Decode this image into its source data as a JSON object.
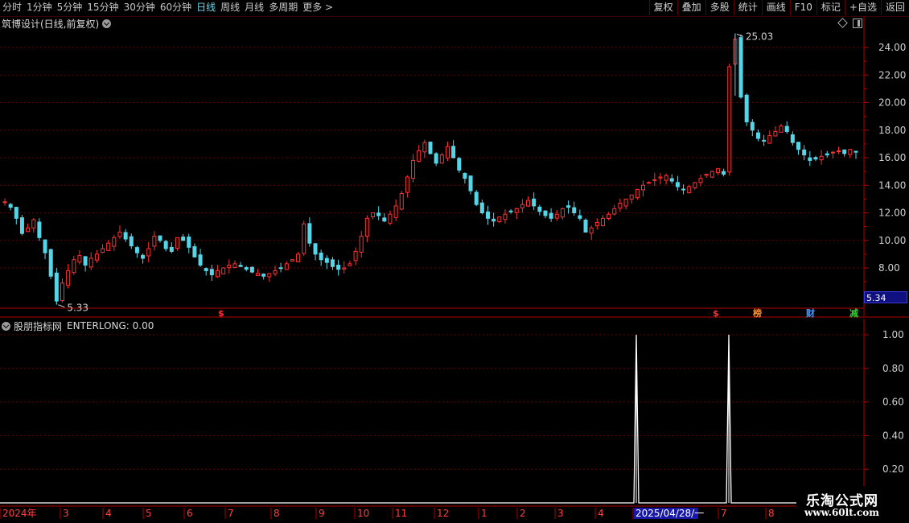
{
  "toolbar": {
    "periods": [
      "分时",
      "1分钟",
      "5分钟",
      "15分钟",
      "30分钟",
      "60分钟",
      "日线",
      "周线",
      "月线",
      "多周期",
      "更多"
    ],
    "more_arrow": ">",
    "active_period": "日线",
    "tools": [
      "复权",
      "叠加",
      "多股",
      "统计",
      "画线",
      "F10",
      "标记",
      "+自选",
      "返回"
    ]
  },
  "main_chart": {
    "title": "筑博设计(日线,前复权)",
    "high_label": "25.03",
    "low_label": "5.33",
    "current_price": "5.34",
    "y_ticks": [
      "24.00",
      "22.00",
      "20.00",
      "18.00",
      "16.00",
      "14.00",
      "12.00",
      "10.00",
      "8.00"
    ],
    "events": [
      {
        "text": "$",
        "color": "#ff3030"
      },
      {
        "text": "$",
        "color": "#ff3030"
      },
      {
        "text": "榜",
        "color": "#ff9030"
      },
      {
        "text": "财",
        "color": "#4aa0ff"
      },
      {
        "text": "减",
        "color": "#30d030"
      }
    ]
  },
  "indicator": {
    "name": "股朋指标网",
    "value": "ENTERLONG: 0.00",
    "y_ticks": [
      "1.00",
      "0.80",
      "0.60",
      "0.40",
      "0.20"
    ]
  },
  "x_axis": {
    "labels": [
      "2024年",
      "3",
      "4",
      "5",
      "6",
      "7",
      "8",
      "9",
      "10",
      "11",
      "12",
      "1",
      "2",
      "3",
      "4",
      "2025/04/28/一",
      "7",
      "8"
    ]
  },
  "watermark": {
    "title": "乐淘公式网",
    "url": "www.60lt.com"
  },
  "chart_data": [
    {
      "type": "candlestick",
      "title": "筑博设计(日线,前复权)",
      "y_range": [
        5,
        26
      ],
      "period": "daily",
      "close_trend": [
        12.8,
        12.4,
        11.6,
        10.5,
        10.9,
        11.5,
        10.2,
        9.1,
        7.4,
        5.6,
        6.9,
        7.8,
        8.6,
        8.9,
        8.2,
        8.7,
        9.0,
        9.4,
        9.8,
        10.2,
        10.6,
        10.1,
        9.6,
        9.1,
        8.7,
        9.4,
        10.3,
        10.0,
        9.4,
        9.2,
        10.2,
        10.0,
        9.5,
        8.8,
        8.2,
        7.8,
        7.5,
        7.8,
        8.0,
        8.2,
        8.3,
        8.1,
        7.9,
        7.7,
        7.6,
        7.4,
        7.6,
        7.8,
        8.0,
        8.3,
        8.6,
        9.0,
        11.2,
        9.8,
        9.0,
        8.6,
        8.4,
        8.1,
        7.9,
        8.0,
        8.3,
        9.2,
        10.3,
        11.6,
        12.0,
        11.8,
        11.4,
        11.9,
        12.5,
        13.4,
        14.6,
        15.8,
        16.5,
        17.1,
        16.3,
        15.6,
        16.2,
        16.8,
        16.0,
        15.1,
        14.5,
        13.6,
        12.6,
        12.0,
        11.6,
        11.4,
        11.7,
        11.9,
        12.1,
        12.3,
        12.6,
        12.9,
        12.5,
        12.1,
        11.8,
        11.6,
        11.9,
        12.3,
        12.4,
        12.0,
        11.6,
        10.6,
        10.9,
        11.3,
        11.6,
        11.9,
        12.3,
        12.7,
        13.0,
        13.3,
        13.7,
        14.0,
        14.2,
        14.4,
        14.6,
        14.7,
        14.3,
        13.9,
        13.7,
        13.9,
        14.2,
        14.5,
        14.8,
        15.0,
        15.2,
        14.8,
        22.6,
        24.6,
        20.4,
        18.6,
        18.0,
        17.4,
        17.2,
        17.6,
        17.9,
        18.3,
        17.9,
        17.1,
        16.6,
        16.2,
        15.8,
        15.9,
        16.1,
        16.2,
        16.4,
        16.5,
        16.3,
        16.6,
        16.4
      ],
      "high": 25.03,
      "low": 5.33,
      "last": 5.34
    },
    {
      "type": "line",
      "title": "股朋指标网",
      "series": [
        {
          "name": "ENTERLONG",
          "spikes": [
            {
              "x_label": "2025/04/28/一",
              "value": 1.0
            },
            {
              "x_label": "7",
              "value": 1.0
            }
          ],
          "baseline": 0.0
        }
      ],
      "y_ticks": [
        1.0,
        0.8,
        0.6,
        0.4,
        0.2
      ],
      "last": 0.0
    }
  ]
}
